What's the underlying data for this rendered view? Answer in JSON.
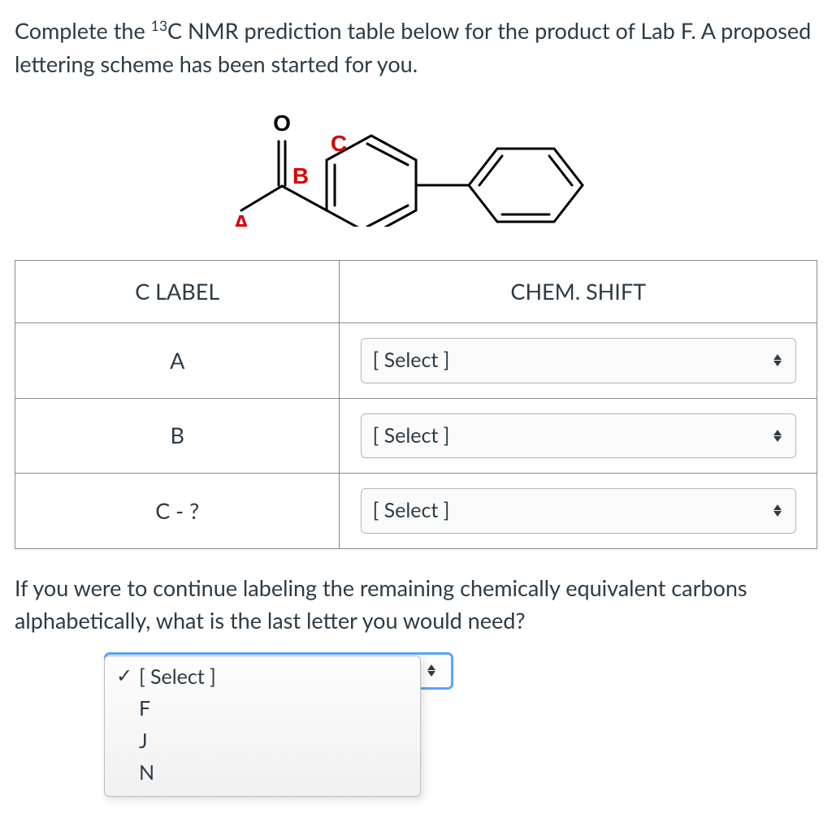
{
  "question": {
    "text_before_sup": "Complete the ",
    "sup": "13",
    "text_after_sup": "C NMR prediction table below for the product of Lab F. A proposed lettering scheme has been started for you."
  },
  "structure": {
    "labels": {
      "a": "A",
      "b": "B",
      "c": "C",
      "o": "O"
    }
  },
  "table": {
    "headers": {
      "c_label": "C LABEL",
      "chem_shift": "CHEM. SHIFT"
    },
    "rows": [
      {
        "label": "A",
        "select_placeholder": "[ Select ]"
      },
      {
        "label": "B",
        "select_placeholder": "[ Select ]"
      },
      {
        "label": "C - ?",
        "select_placeholder": "[ Select ]"
      }
    ]
  },
  "followup": {
    "text": "If you were to continue labeling the remaining chemically equivalent carbons alphabetically, what is the last letter you would need?"
  },
  "last_letter_select": {
    "placeholder": "[ Select ]",
    "options": [
      "F",
      "J",
      "N"
    ]
  }
}
